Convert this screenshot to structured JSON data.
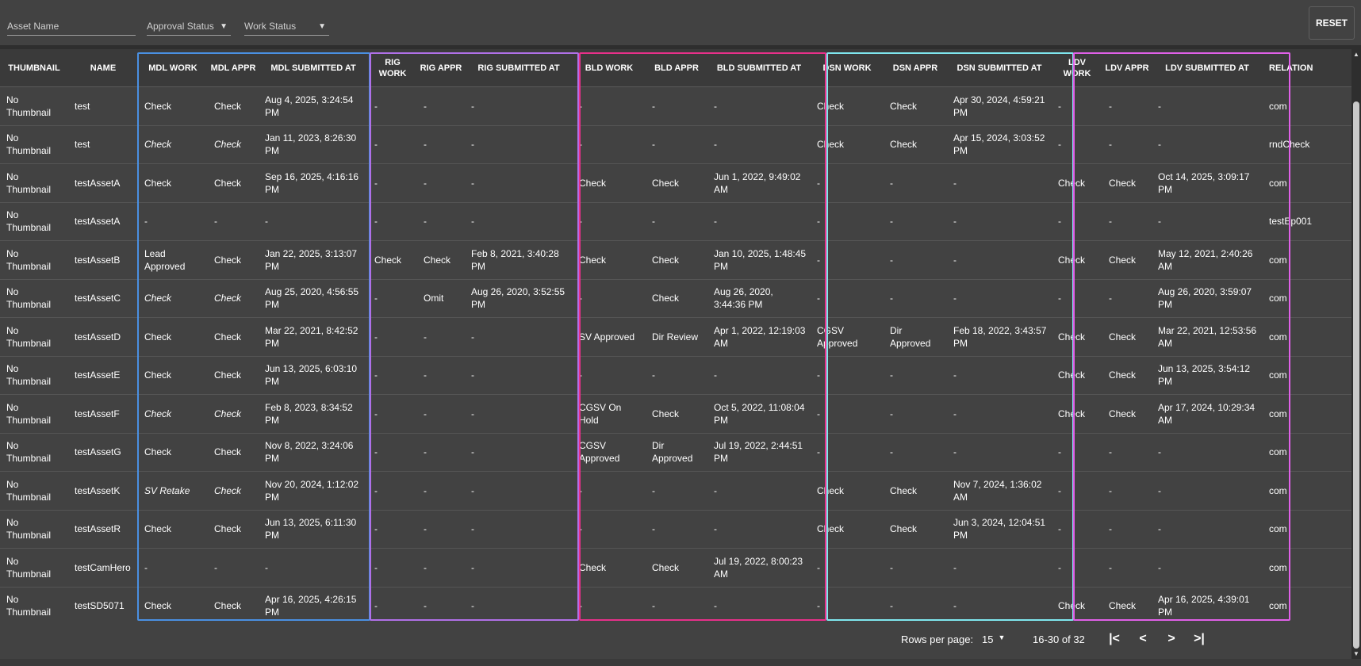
{
  "filters": {
    "asset_name_placeholder": "Asset Name",
    "approval_status_label": "Approval Status",
    "work_status_label": "Work Status",
    "reset_label": "RESET"
  },
  "colors": {
    "mdl": "#4a90e2",
    "rig": "#b070e8",
    "bld": "#e8308a",
    "dsn": "#7fe6ee",
    "ldv": "#e060e8"
  },
  "columns": [
    "THUMBNAIL",
    "NAME",
    "MDL WORK",
    "MDL APPR",
    "MDL SUBMITTED AT",
    "RIG WORK",
    "RIG APPR",
    "RIG SUBMITTED AT",
    "BLD WORK",
    "BLD APPR",
    "BLD SUBMITTED AT",
    "DSN WORK",
    "DSN APPR",
    "DSN SUBMITTED AT",
    "LDV WORK",
    "LDV APPR",
    "LDV SUBMITTED AT",
    "RELATION"
  ],
  "rows": [
    {
      "thumbnail": "No Thumbnail",
      "name": "test",
      "mdl": [
        "Check",
        "Check",
        "Aug 4, 2025, 3:24:54 PM"
      ],
      "rig": [
        "-",
        "-",
        "-"
      ],
      "bld": [
        "-",
        "-",
        "-"
      ],
      "dsn": [
        "Check",
        "Check",
        "Apr 30, 2024, 4:59:21 PM"
      ],
      "ldv": [
        "-",
        "-",
        "-"
      ],
      "relation": "com"
    },
    {
      "thumbnail": "No Thumbnail",
      "name": "test",
      "mdl": [
        "Check*",
        "Check*",
        "Jan 11, 2023, 8:26:30 PM"
      ],
      "rig": [
        "-",
        "-",
        "-"
      ],
      "bld": [
        "-",
        "-",
        "-"
      ],
      "dsn": [
        "Check",
        "Check",
        "Apr 15, 2024, 3:03:52 PM"
      ],
      "ldv": [
        "-",
        "-",
        "-"
      ],
      "relation": "rndCheck"
    },
    {
      "thumbnail": "No Thumbnail",
      "name": "testAssetA",
      "mdl": [
        "Check",
        "Check",
        "Sep 16, 2025, 4:16:16 PM"
      ],
      "rig": [
        "-",
        "-",
        "-"
      ],
      "bld": [
        "Check",
        "Check",
        "Jun 1, 2022, 9:49:02 AM"
      ],
      "dsn": [
        "-",
        "-",
        "-"
      ],
      "ldv": [
        "Check",
        "Check",
        "Oct 14, 2025, 3:09:17 PM"
      ],
      "relation": "com"
    },
    {
      "thumbnail": "No Thumbnail",
      "name": "testAssetA",
      "mdl": [
        "-",
        "-",
        "-"
      ],
      "rig": [
        "-",
        "-",
        "-"
      ],
      "bld": [
        "-",
        "-",
        "-"
      ],
      "dsn": [
        "-",
        "-",
        "-"
      ],
      "ldv": [
        "-",
        "-",
        "-"
      ],
      "relation": "testEp001"
    },
    {
      "thumbnail": "No Thumbnail",
      "name": "testAssetB",
      "mdl": [
        "Lead Approved",
        "Check",
        "Jan 22, 2025, 3:13:07 PM"
      ],
      "rig": [
        "Check",
        "Check",
        "Feb 8, 2021, 3:40:28 PM"
      ],
      "bld": [
        "Check",
        "Check",
        "Jan 10, 2025, 1:48:45 PM"
      ],
      "dsn": [
        "-",
        "-",
        "-"
      ],
      "ldv": [
        "Check",
        "Check",
        "May 12, 2021, 2:40:26 AM"
      ],
      "relation": "com"
    },
    {
      "thumbnail": "No Thumbnail",
      "name": "testAssetC",
      "mdl": [
        "Check*",
        "Check*",
        "Aug 25, 2020, 4:56:55 PM"
      ],
      "rig": [
        "-",
        "Omit",
        "Aug 26, 2020, 3:52:55 PM"
      ],
      "bld": [
        "-",
        "Check",
        "Aug 26, 2020, 3:44:36 PM"
      ],
      "dsn": [
        "-",
        "-",
        "-"
      ],
      "ldv": [
        "-",
        "-",
        "Aug 26, 2020, 3:59:07 PM"
      ],
      "relation": "com"
    },
    {
      "thumbnail": "No Thumbnail",
      "name": "testAssetD",
      "mdl": [
        "Check",
        "Check",
        "Mar 22, 2021, 8:42:52 PM"
      ],
      "rig": [
        "-",
        "-",
        "-"
      ],
      "bld": [
        "SV Approved",
        "Dir Review",
        "Apr 1, 2022, 12:19:03 AM"
      ],
      "dsn": [
        "CGSV Approved",
        "Dir Approved",
        "Feb 18, 2022, 3:43:57 PM"
      ],
      "ldv": [
        "Check",
        "Check",
        "Mar 22, 2021, 12:53:56 AM"
      ],
      "relation": "com"
    },
    {
      "thumbnail": "No Thumbnail",
      "name": "testAssetE",
      "mdl": [
        "Check",
        "Check",
        "Jun 13, 2025, 6:03:10 PM"
      ],
      "rig": [
        "-",
        "-",
        "-"
      ],
      "bld": [
        "-",
        "-",
        "-"
      ],
      "dsn": [
        "-",
        "-",
        "-"
      ],
      "ldv": [
        "Check",
        "Check",
        "Jun 13, 2025, 3:54:12 PM"
      ],
      "relation": "com"
    },
    {
      "thumbnail": "No Thumbnail",
      "name": "testAssetF",
      "mdl": [
        "Check*",
        "Check*",
        "Feb 8, 2023, 8:34:52 PM"
      ],
      "rig": [
        "-",
        "-",
        "-"
      ],
      "bld": [
        "CGSV On Hold",
        "Check",
        "Oct 5, 2022, 11:08:04 PM"
      ],
      "dsn": [
        "-",
        "-",
        "-"
      ],
      "ldv": [
        "Check",
        "Check",
        "Apr 17, 2024, 10:29:34 AM"
      ],
      "relation": "com"
    },
    {
      "thumbnail": "No Thumbnail",
      "name": "testAssetG",
      "mdl": [
        "Check",
        "Check",
        "Nov 8, 2022, 3:24:06 PM"
      ],
      "rig": [
        "-",
        "-",
        "-"
      ],
      "bld": [
        "CGSV Approved",
        "Dir Approved",
        "Jul 19, 2022, 2:44:51 PM"
      ],
      "dsn": [
        "-",
        "-",
        "-"
      ],
      "ldv": [
        "-",
        "-",
        "-"
      ],
      "relation": "com"
    },
    {
      "thumbnail": "No Thumbnail",
      "name": "testAssetK",
      "mdl": [
        "SV Retake",
        "Check*",
        "Nov 20, 2024, 1:12:02 PM"
      ],
      "rig": [
        "-",
        "-",
        "-"
      ],
      "bld": [
        "-",
        "-",
        "-"
      ],
      "dsn": [
        "Check",
        "Check",
        "Nov 7, 2024, 1:36:02 AM"
      ],
      "ldv": [
        "-",
        "-",
        "-"
      ],
      "relation": "com"
    },
    {
      "thumbnail": "No Thumbnail",
      "name": "testAssetR",
      "mdl": [
        "Check",
        "Check",
        "Jun 13, 2025, 6:11:30 PM"
      ],
      "rig": [
        "-",
        "-",
        "-"
      ],
      "bld": [
        "-",
        "-",
        "-"
      ],
      "dsn": [
        "Check",
        "Check",
        "Jun 3, 2024, 12:04:51 PM"
      ],
      "ldv": [
        "-",
        "-",
        "-"
      ],
      "relation": "com"
    },
    {
      "thumbnail": "No Thumbnail",
      "name": "testCamHero",
      "mdl": [
        "-",
        "-",
        "-"
      ],
      "rig": [
        "-",
        "-",
        "-"
      ],
      "bld": [
        "Check",
        "Check",
        "Jul 19, 2022, 8:00:23 AM"
      ],
      "dsn": [
        "-",
        "-",
        "-"
      ],
      "ldv": [
        "-",
        "-",
        "-"
      ],
      "relation": "com"
    },
    {
      "thumbnail": "No Thumbnail",
      "name": "testSD5071",
      "mdl": [
        "Check",
        "Check",
        "Apr 16, 2025, 4:26:15 PM"
      ],
      "rig": [
        "-",
        "-",
        "-"
      ],
      "bld": [
        "-",
        "-",
        "-"
      ],
      "dsn": [
        "-",
        "-",
        "-"
      ],
      "ldv": [
        "Check",
        "Check",
        "Apr 16, 2025, 4:39:01 PM"
      ],
      "relation": "com"
    }
  ],
  "pagination": {
    "rows_per_page_label": "Rows per page:",
    "rows_per_page_value": "15",
    "range_text": "16-30 of 32",
    "first_icon": "first-page-icon",
    "prev_icon": "chevron-left-icon",
    "next_icon": "chevron-right-icon",
    "last_icon": "last-page-icon"
  }
}
